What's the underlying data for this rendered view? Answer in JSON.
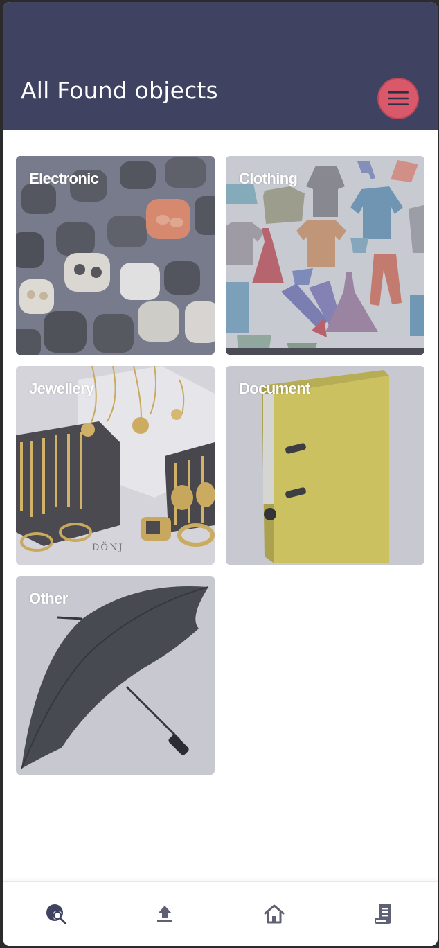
{
  "header": {
    "title": "All Found objects",
    "menu_icon": "hamburger-menu-icon"
  },
  "categories": [
    {
      "label": "Electronic",
      "image": "earbuds-cases-photo"
    },
    {
      "label": "Clothing",
      "image": "clothing-pattern-illustration"
    },
    {
      "label": "Jewellery",
      "image": "gold-chains-and-rings-photo"
    },
    {
      "label": "Document",
      "image": "yellow-lever-arch-binder-photo"
    },
    {
      "label": "Other",
      "image": "black-umbrella-photo"
    }
  ],
  "bottom_nav": [
    {
      "icon": "search-found-icon"
    },
    {
      "icon": "upload-icon"
    },
    {
      "icon": "home-icon"
    },
    {
      "icon": "report-list-icon"
    }
  ],
  "colors": {
    "header_bg": "#3f4261",
    "accent": "#d9596a",
    "nav_icon": "#5f6073",
    "tile_overlay": "#c8c9d1"
  }
}
